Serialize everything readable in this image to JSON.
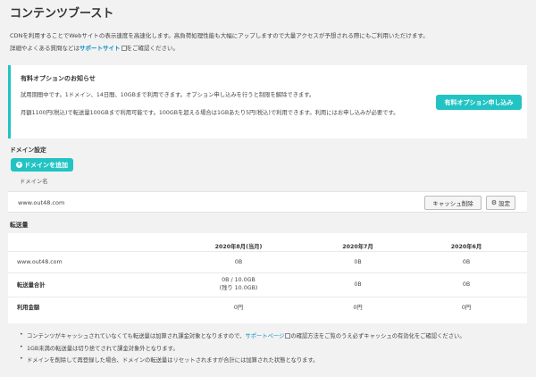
{
  "page": {
    "title": "コンテンツブースト",
    "desc_line1": "CDNを利用することでWebサイトの表示速度を高速化します。高負荷処理性能も大幅にアップしますので大量アクセスが予想される際にもご利用いただけます。",
    "desc_line2_pre": "詳細やよくある質問などは",
    "desc_line2_link": "サポートサイト",
    "desc_line2_post": "をご確認ください。"
  },
  "notice": {
    "title": "有料オプションのお知らせ",
    "line1": "試用期間中です。1ドメイン、14日間、10GBまで利用できます。オプション申し込みを行うと制限を解除できます。",
    "line2": "月額1100円(税込)で転送量100GBまで利用可能です。100GBを超える場合は1GBあたり5円(税込)で利用できます。利用にはお申し込みが必要です。",
    "apply_button": "有料オプション申し込み"
  },
  "domain_settings": {
    "label": "ドメイン設定",
    "add_button": "ドメインを追加",
    "column_header": "ドメイン名",
    "rows": [
      {
        "domain": "www.out48.com",
        "cache_button": "キャッシュ削除",
        "settings_button": "設定"
      }
    ]
  },
  "traffic": {
    "label": "転送量",
    "headers": [
      "",
      "2020年8月(当月)",
      "2020年7月",
      "2020年6月"
    ],
    "rows": [
      {
        "label": "www.out48.com",
        "cells": [
          "0B",
          "0B",
          "0B"
        ]
      },
      {
        "label": "転送量合計",
        "cell0_line1": "0B / 10.0GB",
        "cell0_line2": "(残り 10.0GB)",
        "cells": [
          "0B",
          "0B"
        ]
      },
      {
        "label": "利用金額",
        "cells": [
          "0円",
          "0円",
          "0円"
        ]
      }
    ]
  },
  "notes": {
    "note1_pre": "コンテンツがキャッシュされていなくても転送量は加算され課金対象となりますので、",
    "note1_link": "サポートページ",
    "note1_post": "の確認方法をご覧のうえ必ずキャッシュの有効化をご確認ください。",
    "note2": "1GB未満の転送量は切り捨てされて課金対象外となります。",
    "note3": "ドメインを削除して再登録した場合、ドメインの転送量はリセットされますが合計には加算された状態となります。"
  },
  "colors": {
    "accent": "#22c3c3",
    "link": "#0b8ec2"
  }
}
